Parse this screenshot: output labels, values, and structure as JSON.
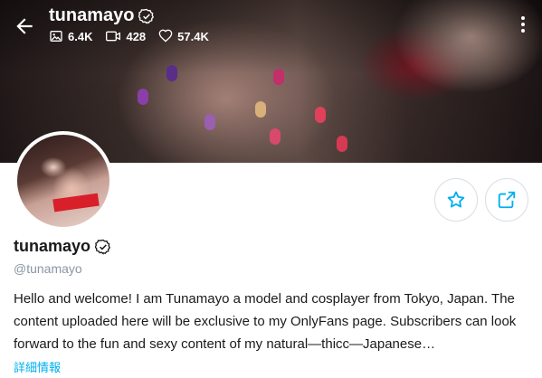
{
  "header": {
    "title": "tunamayo",
    "stats": {
      "photos": "6.4K",
      "videos": "428",
      "likes": "57.4K"
    }
  },
  "profile": {
    "name": "tunamayo",
    "handle": "@tunamayo",
    "bio": "Hello and welcome! I am Tunamayo a model and cosplayer from Tokyo, Japan. The content uploaded here will be exclusive to my OnlyFans page. Subscribers can look forward to the fun and sexy content of my natural—thicc—Japanese…",
    "more_link": "詳細情報"
  },
  "icons": {
    "back": "arrow-left-icon",
    "verified": "verified-badge-icon",
    "photos": "image-icon",
    "videos": "video-icon",
    "likes": "heart-icon",
    "more": "kebab-menu-icon",
    "favorite": "star-icon",
    "share": "share-icon"
  },
  "colors": {
    "accent": "#00aff0",
    "text": "#1a1a1a",
    "muted": "#8a96a3"
  }
}
